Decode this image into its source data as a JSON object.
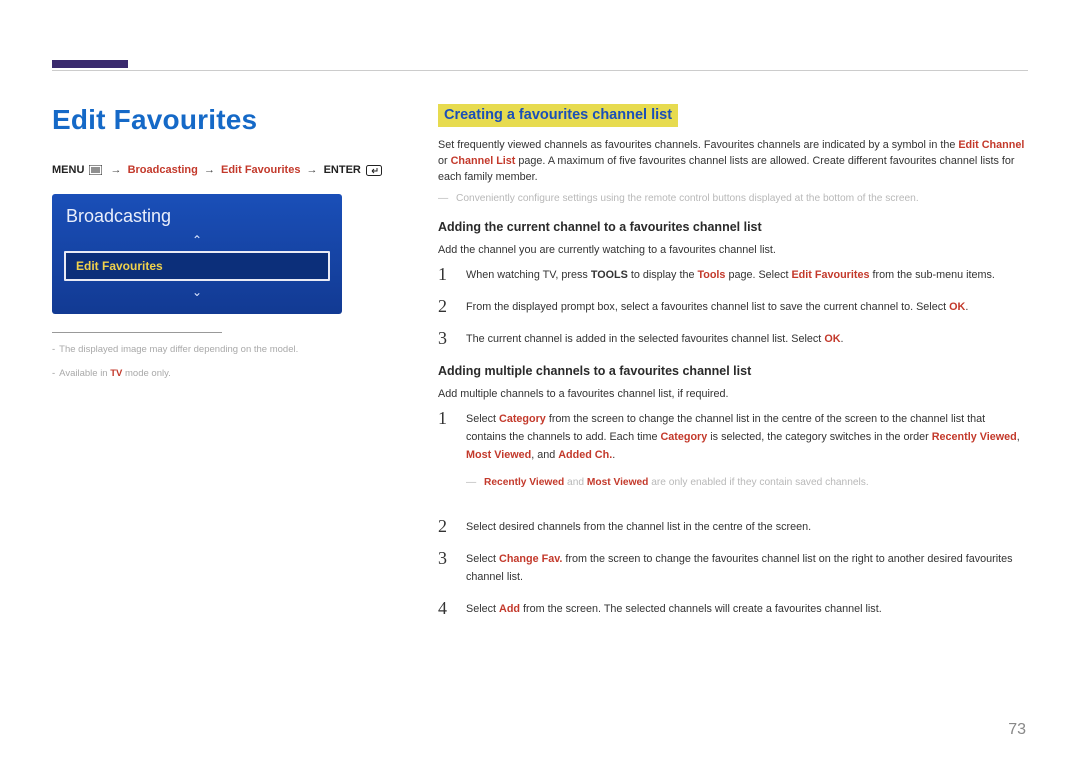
{
  "page_number": "73",
  "left": {
    "title": "Edit Favourites",
    "breadcrumb": {
      "menu": "MENU",
      "path1": "Broadcasting",
      "path2": "Edit Favourites",
      "enter": "ENTER"
    },
    "osd": {
      "header": "Broadcasting",
      "item": "Edit Favourites",
      "up_glyph": "⌃",
      "down_glyph": "⌄"
    },
    "footnote1_prefix": "-",
    "footnote1": "The displayed image may differ depending on the model.",
    "footnote2_prefix": "-",
    "footnote2_a": "Available in ",
    "footnote2_bold": "TV",
    "footnote2_b": " mode only."
  },
  "right": {
    "section_title": "Creating a favourites channel list",
    "intro_a": "Set frequently viewed channels as favourites channels. Favourites channels are indicated by a symbol in the ",
    "intro_bold1": "Edit Channel",
    "intro_b": " or ",
    "intro_bold2": "Channel List",
    "intro_c": " page. A maximum of five favourites channel lists are allowed. Create different favourites channel lists for each family member.",
    "intro_note": "Conveniently configure settings using the remote control buttons displayed at the bottom of the screen.",
    "sub1": "Adding the current channel to a favourites channel list",
    "sub1_desc": "Add the channel you are currently watching to a favourites channel list.",
    "s1_1a": "When watching TV, press ",
    "s1_1b": "TOOLS",
    "s1_1c": " to display the ",
    "s1_1d": "Tools",
    "s1_1e": " page. Select ",
    "s1_1f": "Edit Favourites",
    "s1_1g": " from the sub-menu items.",
    "s1_2a": "From the displayed prompt box, select a favourites channel list to save the current channel to. Select ",
    "s1_2b": "OK",
    "s1_2c": ".",
    "s1_3a": "The current channel is added in the selected favourites channel list. Select ",
    "s1_3b": "OK",
    "s1_3c": ".",
    "sub2": "Adding multiple channels to a favourites channel list",
    "sub2_desc": "Add multiple channels to a favourites channel list, if required.",
    "s2_1a": "Select ",
    "s2_1b": "Category",
    "s2_1c": " from the screen to change the channel list in the centre of the screen to the channel list that contains the channels to add. Each time ",
    "s2_1d": "Category",
    "s2_1e": " is selected, the category switches in the order ",
    "s2_1f": "Recently Viewed",
    "s2_1g": ", ",
    "s2_1h": "Most Viewed",
    "s2_1i": ", and ",
    "s2_1j": "Added Ch.",
    "s2_1k": ".",
    "s2_note_a": "Recently Viewed",
    "s2_note_b": " and ",
    "s2_note_c": "Most Viewed",
    "s2_note_d": " are only enabled if they contain saved channels.",
    "s2_2": "Select desired channels from the channel list in the centre of the screen.",
    "s2_3a": "Select ",
    "s2_3b": "Change Fav.",
    "s2_3c": " from the screen to change the favourites channel list on the right to another desired favourites channel list.",
    "s2_4a": "Select ",
    "s2_4b": "Add",
    "s2_4c": " from the screen. The selected channels will create a favourites channel list.",
    "num1": "1",
    "num2": "2",
    "num3": "3",
    "num4": "4"
  }
}
